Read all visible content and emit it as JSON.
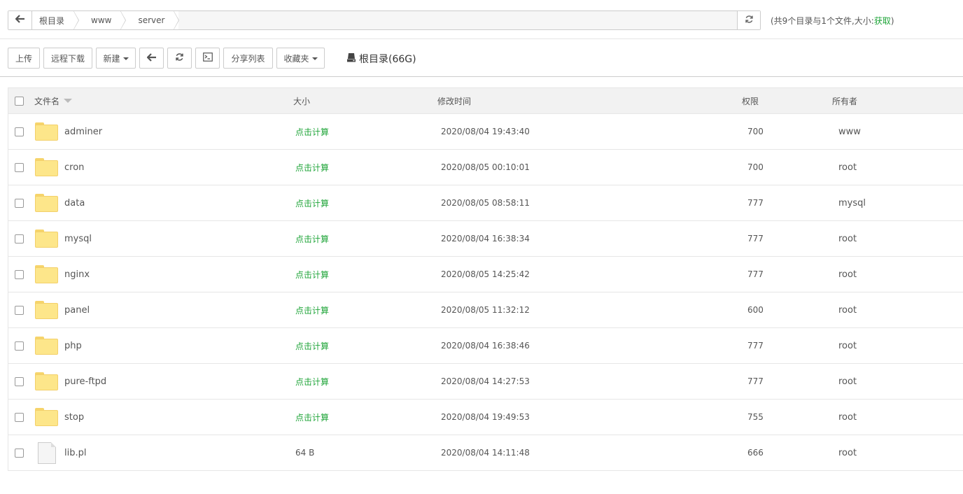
{
  "path": {
    "crumbs": [
      "根目录",
      "www",
      "server"
    ]
  },
  "summary": {
    "text": "(共9个目录与1个文件,大小:",
    "get_label": "获取",
    "close": ")"
  },
  "toolbar": {
    "upload": "上传",
    "remote_download": "远程下载",
    "new": "新建",
    "share_list": "分享列表",
    "favorites": "收藏夹",
    "disk": "根目录(66G)"
  },
  "table": {
    "headers": {
      "name": "文件名",
      "size": "大小",
      "mtime": "修改时间",
      "perm": "权限",
      "owner": "所有者"
    },
    "rows": [
      {
        "type": "folder",
        "name": "adminer",
        "size": "点击计算",
        "mtime": "2020/08/04 19:43:40",
        "perm": "700",
        "owner": "www"
      },
      {
        "type": "folder",
        "name": "cron",
        "size": "点击计算",
        "mtime": "2020/08/05 00:10:01",
        "perm": "700",
        "owner": "root"
      },
      {
        "type": "folder",
        "name": "data",
        "size": "点击计算",
        "mtime": "2020/08/05 08:58:11",
        "perm": "777",
        "owner": "mysql"
      },
      {
        "type": "folder",
        "name": "mysql",
        "size": "点击计算",
        "mtime": "2020/08/04 16:38:34",
        "perm": "777",
        "owner": "root"
      },
      {
        "type": "folder",
        "name": "nginx",
        "size": "点击计算",
        "mtime": "2020/08/05 14:25:42",
        "perm": "777",
        "owner": "root"
      },
      {
        "type": "folder",
        "name": "panel",
        "size": "点击计算",
        "mtime": "2020/08/05 11:32:12",
        "perm": "600",
        "owner": "root"
      },
      {
        "type": "folder",
        "name": "php",
        "size": "点击计算",
        "mtime": "2020/08/04 16:38:46",
        "perm": "777",
        "owner": "root"
      },
      {
        "type": "folder",
        "name": "pure-ftpd",
        "size": "点击计算",
        "mtime": "2020/08/04 14:27:53",
        "perm": "777",
        "owner": "root"
      },
      {
        "type": "folder",
        "name": "stop",
        "size": "点击计算",
        "mtime": "2020/08/04 19:49:53",
        "perm": "755",
        "owner": "root"
      },
      {
        "type": "file",
        "name": "lib.pl",
        "size": "64 B",
        "mtime": "2020/08/04 14:11:48",
        "perm": "666",
        "owner": "root"
      }
    ]
  },
  "colors": {
    "accent_green": "#20a53a",
    "folder_yellow": "#fde68a"
  }
}
